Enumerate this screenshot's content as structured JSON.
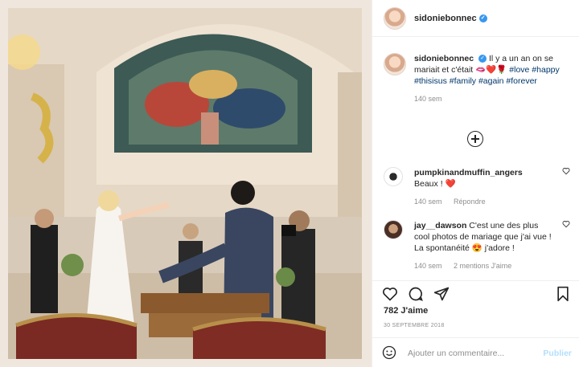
{
  "post": {
    "username": "sidoniebonnec",
    "verified_mark": "✓",
    "caption": {
      "username": "sidoniebonnec",
      "text": "Il y a un an on se mariait et c'était ",
      "emojis": "🫦❤️🌹",
      "hashtags": "#love #happy #thisisus #family #again #forever",
      "time": "140 sem"
    },
    "comments": [
      {
        "username": "pumpkinandmuffin_angers",
        "text": "Beaux ! ",
        "emoji": "❤️",
        "time": "140 sem",
        "reply": "Répondre"
      },
      {
        "username": "jay__dawson",
        "text": "C'est une des plus cool photos de mariage que j'ai vue ! La spontanéité ",
        "emoji": "😍",
        "text_after": " j'adore !",
        "time": "140 sem",
        "mentions": "2 mentions J'aime"
      }
    ],
    "likes": "782 J'aime",
    "date": "30 SEPTEMBRE 2018",
    "comment_placeholder": "Ajouter un commentaire...",
    "publish_label": "Publier"
  },
  "icons": [
    "more-icon",
    "heart-icon",
    "comment-icon",
    "share-icon",
    "bookmark-icon",
    "emoji-icon"
  ],
  "colors": {
    "link": "#00376b",
    "meta": "#8e8e8e",
    "verified": "#3897f0",
    "publish": "#b2dffc"
  }
}
